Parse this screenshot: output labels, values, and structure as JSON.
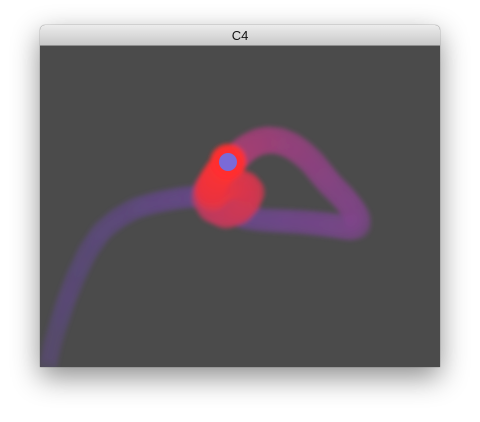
{
  "window": {
    "title": "C4"
  },
  "canvas": {
    "background": "#4b4b4b",
    "trail_color_head": "#ff3030",
    "trail_color_tail": "#6a4aa0",
    "cursor_color": "#7a6ad8"
  }
}
